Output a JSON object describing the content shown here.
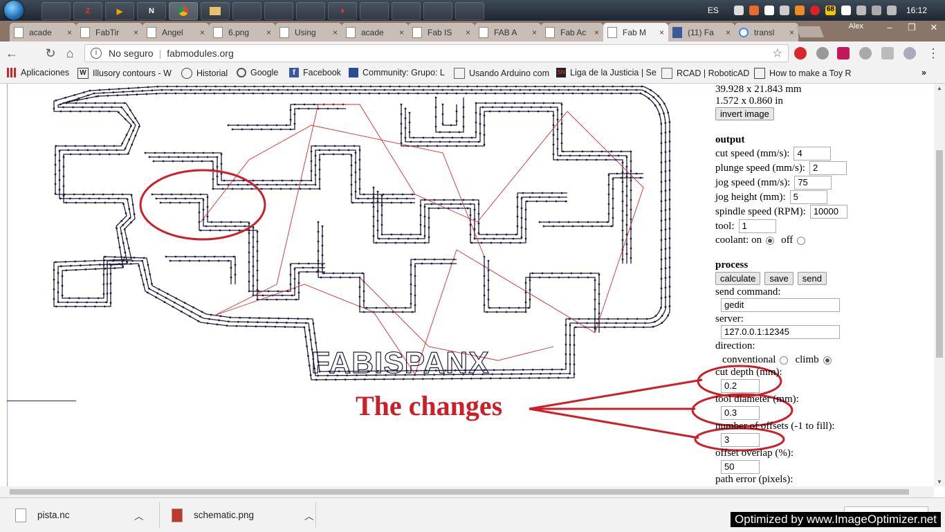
{
  "os": {
    "language": "ES",
    "clock": "16:12",
    "tray_badge": "68",
    "taskbar_apps": [
      "gimp",
      "pcb",
      "media",
      "notepad",
      "chrome",
      "explorer",
      "app7",
      "app8",
      "notes",
      "adobe",
      "eye",
      "window",
      "paint",
      "calc"
    ]
  },
  "browser": {
    "user": "Alex",
    "tabs": [
      {
        "label": "acade",
        "icon": "page"
      },
      {
        "label": "FabTir",
        "icon": "page"
      },
      {
        "label": "Angel",
        "icon": "page"
      },
      {
        "label": "6.png",
        "icon": "page"
      },
      {
        "label": "Using",
        "icon": "page"
      },
      {
        "label": "acade",
        "icon": "page"
      },
      {
        "label": "Fab IS",
        "icon": "page"
      },
      {
        "label": "FAB A",
        "icon": "page"
      },
      {
        "label": "Fab Ac",
        "icon": "page"
      },
      {
        "label": "Fab M",
        "icon": "page"
      },
      {
        "label": "(11) Fa",
        "icon": "facebook"
      },
      {
        "label": "transl",
        "icon": "google"
      }
    ],
    "security_label": "No seguro",
    "url": "fabmodules.org",
    "bookmarks": [
      "Aplicaciones",
      "Illusory contours - W",
      "Historial",
      "Google",
      "Facebook",
      "Community: Grupo: L",
      "Usando Arduino com",
      "Liga de la Justicia | Se",
      "RCAD | RoboticAD",
      "How to make a Toy R"
    ],
    "bookmarks_more": "»"
  },
  "preview": {
    "board_text": "FABISPANX"
  },
  "annotation": {
    "label": "The changes",
    "color": "#cc1f27"
  },
  "settings": {
    "size_mm": "39.928 x 21.843 mm",
    "size_in": "1.572 x 0.860 in",
    "invert_button": "invert image",
    "output_heading": "output",
    "cut_speed_label": "cut speed (mm/s):",
    "cut_speed": "4",
    "plunge_speed_label": "plunge speed (mm/s):",
    "plunge_speed": "2",
    "jog_speed_label": "jog speed (mm/s):",
    "jog_speed": "75",
    "jog_height_label": "jog height (mm):",
    "jog_height": "5",
    "spindle_speed_label": "spindle speed (RPM):",
    "spindle_speed": "10000",
    "tool_label": "tool:",
    "tool": "1",
    "coolant_label": "coolant: on",
    "coolant_off_label": "off",
    "process_heading": "process",
    "calculate_button": "calculate",
    "save_button": "save",
    "send_button": "send",
    "send_command_label": "send command:",
    "send_command": "gedit",
    "server_label": "server:",
    "server": "127.0.0.1:12345",
    "direction_label": "direction:",
    "conventional_label": "conventional",
    "climb_label": "climb",
    "cut_depth_label": "cut depth (mm):",
    "cut_depth": "0.2",
    "tool_diameter_label": "tool diameter (mm):",
    "tool_diameter": "0.3",
    "offsets_label": "number of offsets (-1 to fill):",
    "offsets": "3",
    "offset_overlap_label": "offset overlap (%):",
    "offset_overlap": "50",
    "path_error_label": "path error (pixels):"
  },
  "downloads": [
    {
      "name": "pista.nc"
    },
    {
      "name": "schematic.png"
    }
  ],
  "watermark": "Optimized by www.ImageOptimizer.net"
}
